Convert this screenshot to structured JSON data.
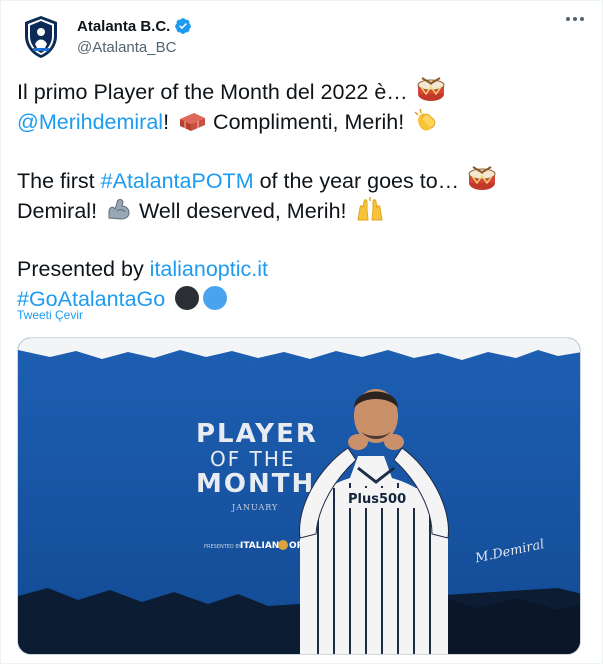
{
  "account": {
    "display_name": "Atalanta B.C.",
    "handle": "@Atalanta_BC",
    "verified": true
  },
  "tweet": {
    "line1_text": "Il primo Player of the Month del 2022 è…",
    "line1_emoji": "drum-emoji",
    "mention": "@Merihdemiral",
    "line2_after_mention": "!",
    "line2_emoji_a": "brick-emoji",
    "line2_text": " Complimenti, Merih!",
    "line2_emoji_b": "clapping-hands-emoji",
    "line3_pre": "The first ",
    "hashtag1": "#AtalantaPOTM",
    "line3_post": " of the year goes to…",
    "line3_emoji": "drum-emoji",
    "line4_pre": "Demiral!",
    "line4_emoji_a": "flexed-biceps-emoji",
    "line4_text": " Well deserved, Merih!",
    "line4_emoji_b": "raising-hands-emoji",
    "line5_pre": "Presented by ",
    "sponsor_link": "italianoptic.it",
    "hashtag2": "#GoAtalantaGo",
    "circle_colors": [
      "#2b2f33",
      "#4aa3ee"
    ]
  },
  "translate_label": "Tweeti Çevir",
  "media": {
    "title_line1": "PLAYER",
    "title_line2": "OF THE",
    "title_line3": "MONTH",
    "month": "JANUARY",
    "presented_by": "PRESENTED BY",
    "sponsor_logo_a": "ITALIAN",
    "sponsor_logo_b": "OPTIC",
    "shirt_sponsor": "Plus500",
    "signature": "M.Demiral"
  },
  "colors": {
    "link": "#1d9bf0",
    "verified": "#1d9bf0",
    "media_blue": "#1a56a6",
    "text": "#0f1419",
    "secondary": "#536471"
  }
}
